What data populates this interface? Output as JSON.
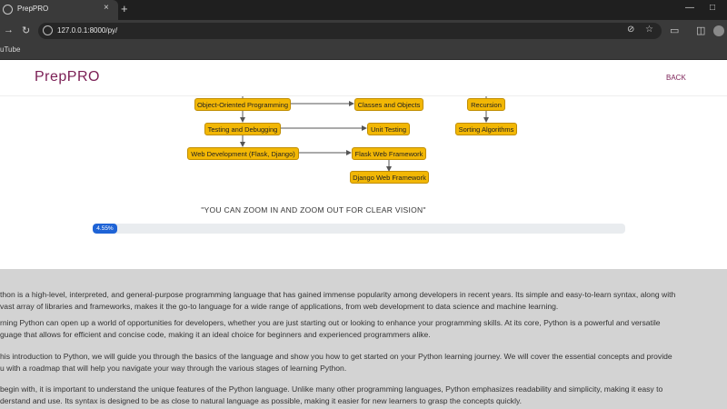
{
  "browser": {
    "tab_title": "PrepPRO",
    "tab_close": "×",
    "new_tab": "+",
    "url": "127.0.0.1:8000/py/",
    "bookmark": "uTube"
  },
  "header": {
    "logo": "PrepPRO",
    "back": "BACK"
  },
  "roadmap": {
    "nodes": {
      "oop": "Object-Oriented Programming",
      "classes": "Classes and Objects",
      "recursion": "Recursion",
      "testing": "Testing and Debugging",
      "unit": "Unit Testing",
      "sorting": "Sorting Algorithms",
      "webdev": "Web Development (Flask, Django)",
      "flask": "Flask Web Framework",
      "django": "Django Web Framework"
    }
  },
  "zoom_note": "\"YOU CAN ZOOM IN AND ZOOM OUT FOR CLEAR VISION\"",
  "progress": {
    "label": "4.55%",
    "value_percent": 4.55
  },
  "intro": {
    "p1_l1": "thon is a high-level, interpreted, and general-purpose programming language that has gained immense popularity among developers in recent years. Its simple and easy-to-learn syntax, along with",
    "p1_l2": "vast array of libraries and frameworks, makes it the go-to language for a wide range of applications, from web development to data science and machine learning.",
    "p2_l1": "rning Python can open up a world of opportunities for developers, whether you are just starting out or looking to enhance your programming skills. At its core, Python is a powerful and versatile",
    "p2_l2": "guage that allows for efficient and concise code, making it an ideal choice for beginners and experienced programmers alike.",
    "p3_l1": "his introduction to Python, we will guide you through the basics of the language and show you how to get started on your Python learning journey. We will cover the essential concepts and provide",
    "p3_l2": "u with a roadmap that will help you navigate your way through the various stages of learning Python.",
    "p4_l1": "begin with, it is important to understand the unique features of the Python language. Unlike many other programming languages, Python emphasizes readability and simplicity, making it easy to",
    "p4_l2": "derstand and use. Its syntax is designed to be as close to natural language as possible, making it easier for new learners to grasp the concepts quickly."
  }
}
